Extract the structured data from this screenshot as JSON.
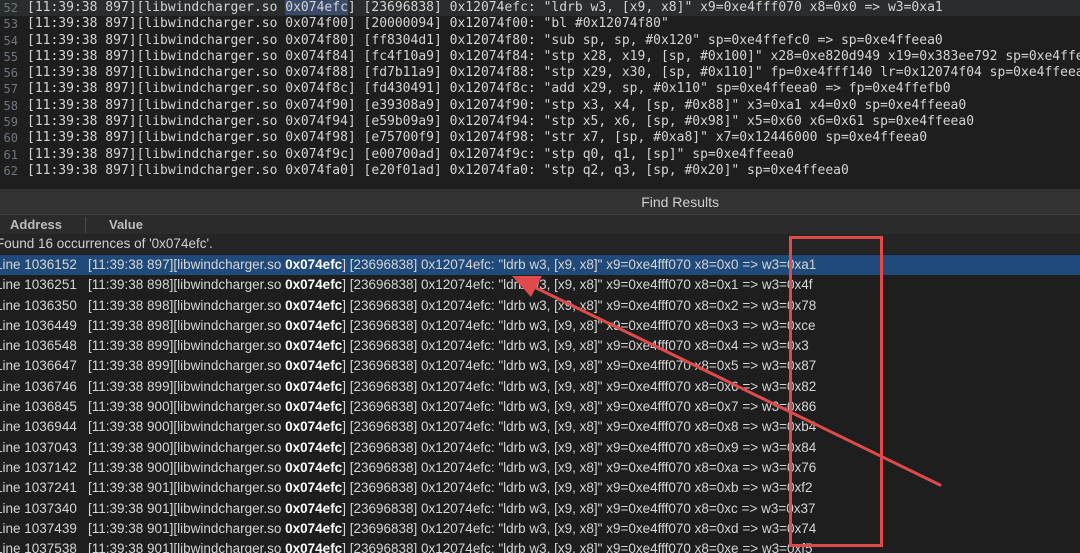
{
  "editor": {
    "lines": [
      {
        "gutter": "52",
        "pre": "[11:39:38 897][libwindcharger.so ",
        "match": "0x074efc",
        "post": "] [23696838] 0x12074efc: \"ldrb w3, [x9, x8]\" x9=0xe4fff070 x8=0x0 => w3=0xa1",
        "current": true
      },
      {
        "gutter": "53",
        "pre": "[11:39:38 897][libwindcharger.so 0x074f00] [20000094] 0x12074f00: \"bl #0x12074f80\"",
        "match": "",
        "post": "",
        "current": false
      },
      {
        "gutter": "54",
        "pre": "[11:39:38 897][libwindcharger.so 0x074f80] [ff8304d1] 0x12074f80: \"sub sp, sp, #0x120\" sp=0xe4ffefc0 => sp=0xe4ffeea0",
        "match": "",
        "post": "",
        "current": false
      },
      {
        "gutter": "55",
        "pre": "[11:39:38 897][libwindcharger.so 0x074f84] [fc4f10a9] 0x12074f84: \"stp x28, x19, [sp, #0x100]\" x28=0xe820d949 x19=0x383ee792 sp=0xe4ffeea0",
        "match": "",
        "post": "",
        "current": false
      },
      {
        "gutter": "56",
        "pre": "[11:39:38 897][libwindcharger.so 0x074f88] [fd7b11a9] 0x12074f88: \"stp x29, x30, [sp, #0x110]\" fp=0xe4fff140 lr=0x12074f04 sp=0xe4ffeea0",
        "match": "",
        "post": "",
        "current": false
      },
      {
        "gutter": "57",
        "pre": "[11:39:38 897][libwindcharger.so 0x074f8c] [fd430491] 0x12074f8c: \"add x29, sp, #0x110\" sp=0xe4ffeea0 => fp=0xe4ffefb0",
        "match": "",
        "post": "",
        "current": false
      },
      {
        "gutter": "58",
        "pre": "[11:39:38 897][libwindcharger.so 0x074f90] [e39308a9] 0x12074f90: \"stp x3, x4, [sp, #0x88]\" x3=0xa1 x4=0x0 sp=0xe4ffeea0",
        "match": "",
        "post": "",
        "current": false
      },
      {
        "gutter": "59",
        "pre": "[11:39:38 897][libwindcharger.so 0x074f94] [e59b09a9] 0x12074f94: \"stp x5, x6, [sp, #0x98]\" x5=0x60 x6=0x61 sp=0xe4ffeea0",
        "match": "",
        "post": "",
        "current": false
      },
      {
        "gutter": "60",
        "pre": "[11:39:38 897][libwindcharger.so 0x074f98] [e75700f9] 0x12074f98: \"str x7, [sp, #0xa8]\" x7=0x12446000 sp=0xe4ffeea0",
        "match": "",
        "post": "",
        "current": false
      },
      {
        "gutter": "61",
        "pre": "[11:39:38 897][libwindcharger.so 0x074f9c] [e00700ad] 0x12074f9c: \"stp q0, q1, [sp]\" sp=0xe4ffeea0",
        "match": "",
        "post": "",
        "current": false
      },
      {
        "gutter": "62",
        "pre": "[11:39:38 897][libwindcharger.so 0x074fa0] [e20f01ad] 0x12074fa0: \"stp q2, q3, [sp, #0x20]\" sp=0xe4ffeea0",
        "match": "",
        "post": "",
        "current": false
      }
    ]
  },
  "panel": {
    "title": "Find Results",
    "columns": {
      "address": "Address",
      "value": "Value"
    },
    "summary": "Found 16 occurrences of '0x074efc'."
  },
  "results": [
    {
      "line": "Line 1036152",
      "pre": "[11:39:38 897][libwindcharger.so ",
      "match": "0x074efc",
      "post": "] [23696838] 0x12074efc: \"ldrb w3, [x9, x8]\" x9=0xe4fff070 x8=0x0 => w3=0xa1",
      "selected": true
    },
    {
      "line": "Line 1036251",
      "pre": "[11:39:38 898][libwindcharger.so ",
      "match": "0x074efc",
      "post": "] [23696838] 0x12074efc: \"ldrb w3, [x9, x8]\" x9=0xe4fff070 x8=0x1 => w3=0x4f",
      "selected": false
    },
    {
      "line": "Line 1036350",
      "pre": "[11:39:38 898][libwindcharger.so ",
      "match": "0x074efc",
      "post": "] [23696838] 0x12074efc: \"ldrb w3, [x9, x8]\" x9=0xe4fff070 x8=0x2 => w3=0x78",
      "selected": false
    },
    {
      "line": "Line 1036449",
      "pre": "[11:39:38 898][libwindcharger.so ",
      "match": "0x074efc",
      "post": "] [23696838] 0x12074efc: \"ldrb w3, [x9, x8]\" x9=0xe4fff070 x8=0x3 => w3=0xce",
      "selected": false
    },
    {
      "line": "Line 1036548",
      "pre": "[11:39:38 899][libwindcharger.so ",
      "match": "0x074efc",
      "post": "] [23696838] 0x12074efc: \"ldrb w3, [x9, x8]\" x9=0xe4fff070 x8=0x4 => w3=0x3",
      "selected": false
    },
    {
      "line": "Line 1036647",
      "pre": "[11:39:38 899][libwindcharger.so ",
      "match": "0x074efc",
      "post": "] [23696838] 0x12074efc: \"ldrb w3, [x9, x8]\" x9=0xe4fff070 x8=0x5 => w3=0x87",
      "selected": false
    },
    {
      "line": "Line 1036746",
      "pre": "[11:39:38 899][libwindcharger.so ",
      "match": "0x074efc",
      "post": "] [23696838] 0x12074efc: \"ldrb w3, [x9, x8]\" x9=0xe4fff070 x8=0x6 => w3=0x82",
      "selected": false
    },
    {
      "line": "Line 1036845",
      "pre": "[11:39:38 900][libwindcharger.so ",
      "match": "0x074efc",
      "post": "] [23696838] 0x12074efc: \"ldrb w3, [x9, x8]\" x9=0xe4fff070 x8=0x7 => w3=0x86",
      "selected": false
    },
    {
      "line": "Line 1036944",
      "pre": "[11:39:38 900][libwindcharger.so ",
      "match": "0x074efc",
      "post": "] [23696838] 0x12074efc: \"ldrb w3, [x9, x8]\" x9=0xe4fff070 x8=0x8 => w3=0xb4",
      "selected": false
    },
    {
      "line": "Line 1037043",
      "pre": "[11:39:38 900][libwindcharger.so ",
      "match": "0x074efc",
      "post": "] [23696838] 0x12074efc: \"ldrb w3, [x9, x8]\" x9=0xe4fff070 x8=0x9 => w3=0x84",
      "selected": false
    },
    {
      "line": "Line 1037142",
      "pre": "[11:39:38 900][libwindcharger.so ",
      "match": "0x074efc",
      "post": "] [23696838] 0x12074efc: \"ldrb w3, [x9, x8]\" x9=0xe4fff070 x8=0xa => w3=0x76",
      "selected": false
    },
    {
      "line": "Line 1037241",
      "pre": "[11:39:38 901][libwindcharger.so ",
      "match": "0x074efc",
      "post": "] [23696838] 0x12074efc: \"ldrb w3, [x9, x8]\" x9=0xe4fff070 x8=0xb => w3=0xf2",
      "selected": false
    },
    {
      "line": "Line 1037340",
      "pre": "[11:39:38 901][libwindcharger.so ",
      "match": "0x074efc",
      "post": "] [23696838] 0x12074efc: \"ldrb w3, [x9, x8]\" x9=0xe4fff070 x8=0xc => w3=0x37",
      "selected": false
    },
    {
      "line": "Line 1037439",
      "pre": "[11:39:38 901][libwindcharger.so ",
      "match": "0x074efc",
      "post": "] [23696838] 0x12074efc: \"ldrb w3, [x9, x8]\" x9=0xe4fff070 x8=0xd => w3=0x74",
      "selected": false
    },
    {
      "line": "Line 1037538",
      "pre": "[11:39:38 901][libwindcharger.so ",
      "match": "0x074efc",
      "post": "] [23696838] 0x12074efc: \"ldrb w3, [x9, x8]\" x9=0xe4fff070 x8=0xe => w3=0xf5",
      "selected": false
    }
  ],
  "annotation": {
    "color": "#e04a4a"
  }
}
